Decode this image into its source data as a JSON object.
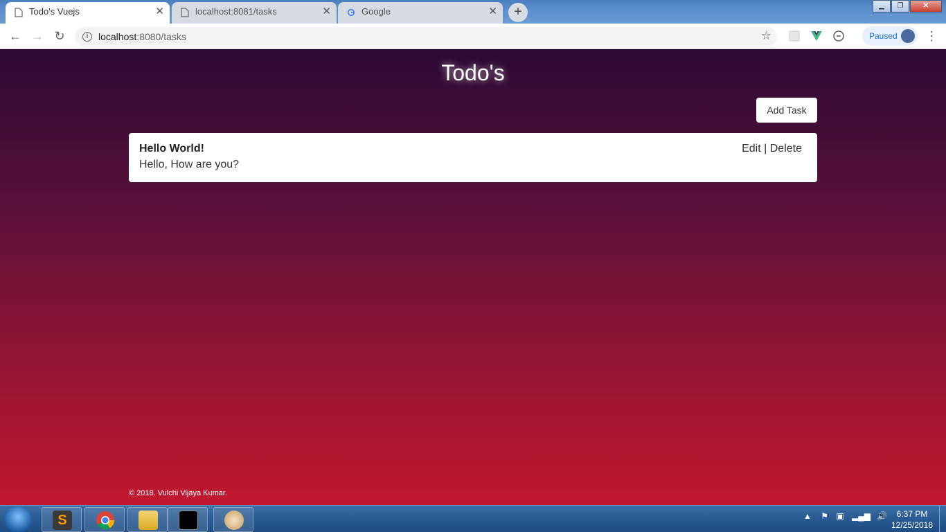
{
  "browser": {
    "tabs": [
      {
        "label": "Todo's Vuejs",
        "active": true
      },
      {
        "label": "localhost:8081/tasks",
        "active": false
      },
      {
        "label": "Google",
        "active": false
      }
    ],
    "new_tab_label": "+",
    "address": {
      "host": "localhost",
      "port_path": ":8080/tasks"
    },
    "profile_status": "Paused"
  },
  "page": {
    "title": "Todo's",
    "add_button_label": "Add Task",
    "tasks": [
      {
        "title": "Hello World!",
        "description": "Hello, How are you?",
        "edit_label": "Edit",
        "separator": "|",
        "delete_label": "Delete"
      }
    ],
    "footer": "© 2018. Vulchi Vijaya Kumar."
  },
  "taskbar": {
    "time": "6:37 PM",
    "date": "12/25/2018"
  },
  "colors": {
    "gradient_top": "#2c0a33",
    "gradient_bottom": "#c2172f",
    "paused_text": "#1a73e8"
  }
}
